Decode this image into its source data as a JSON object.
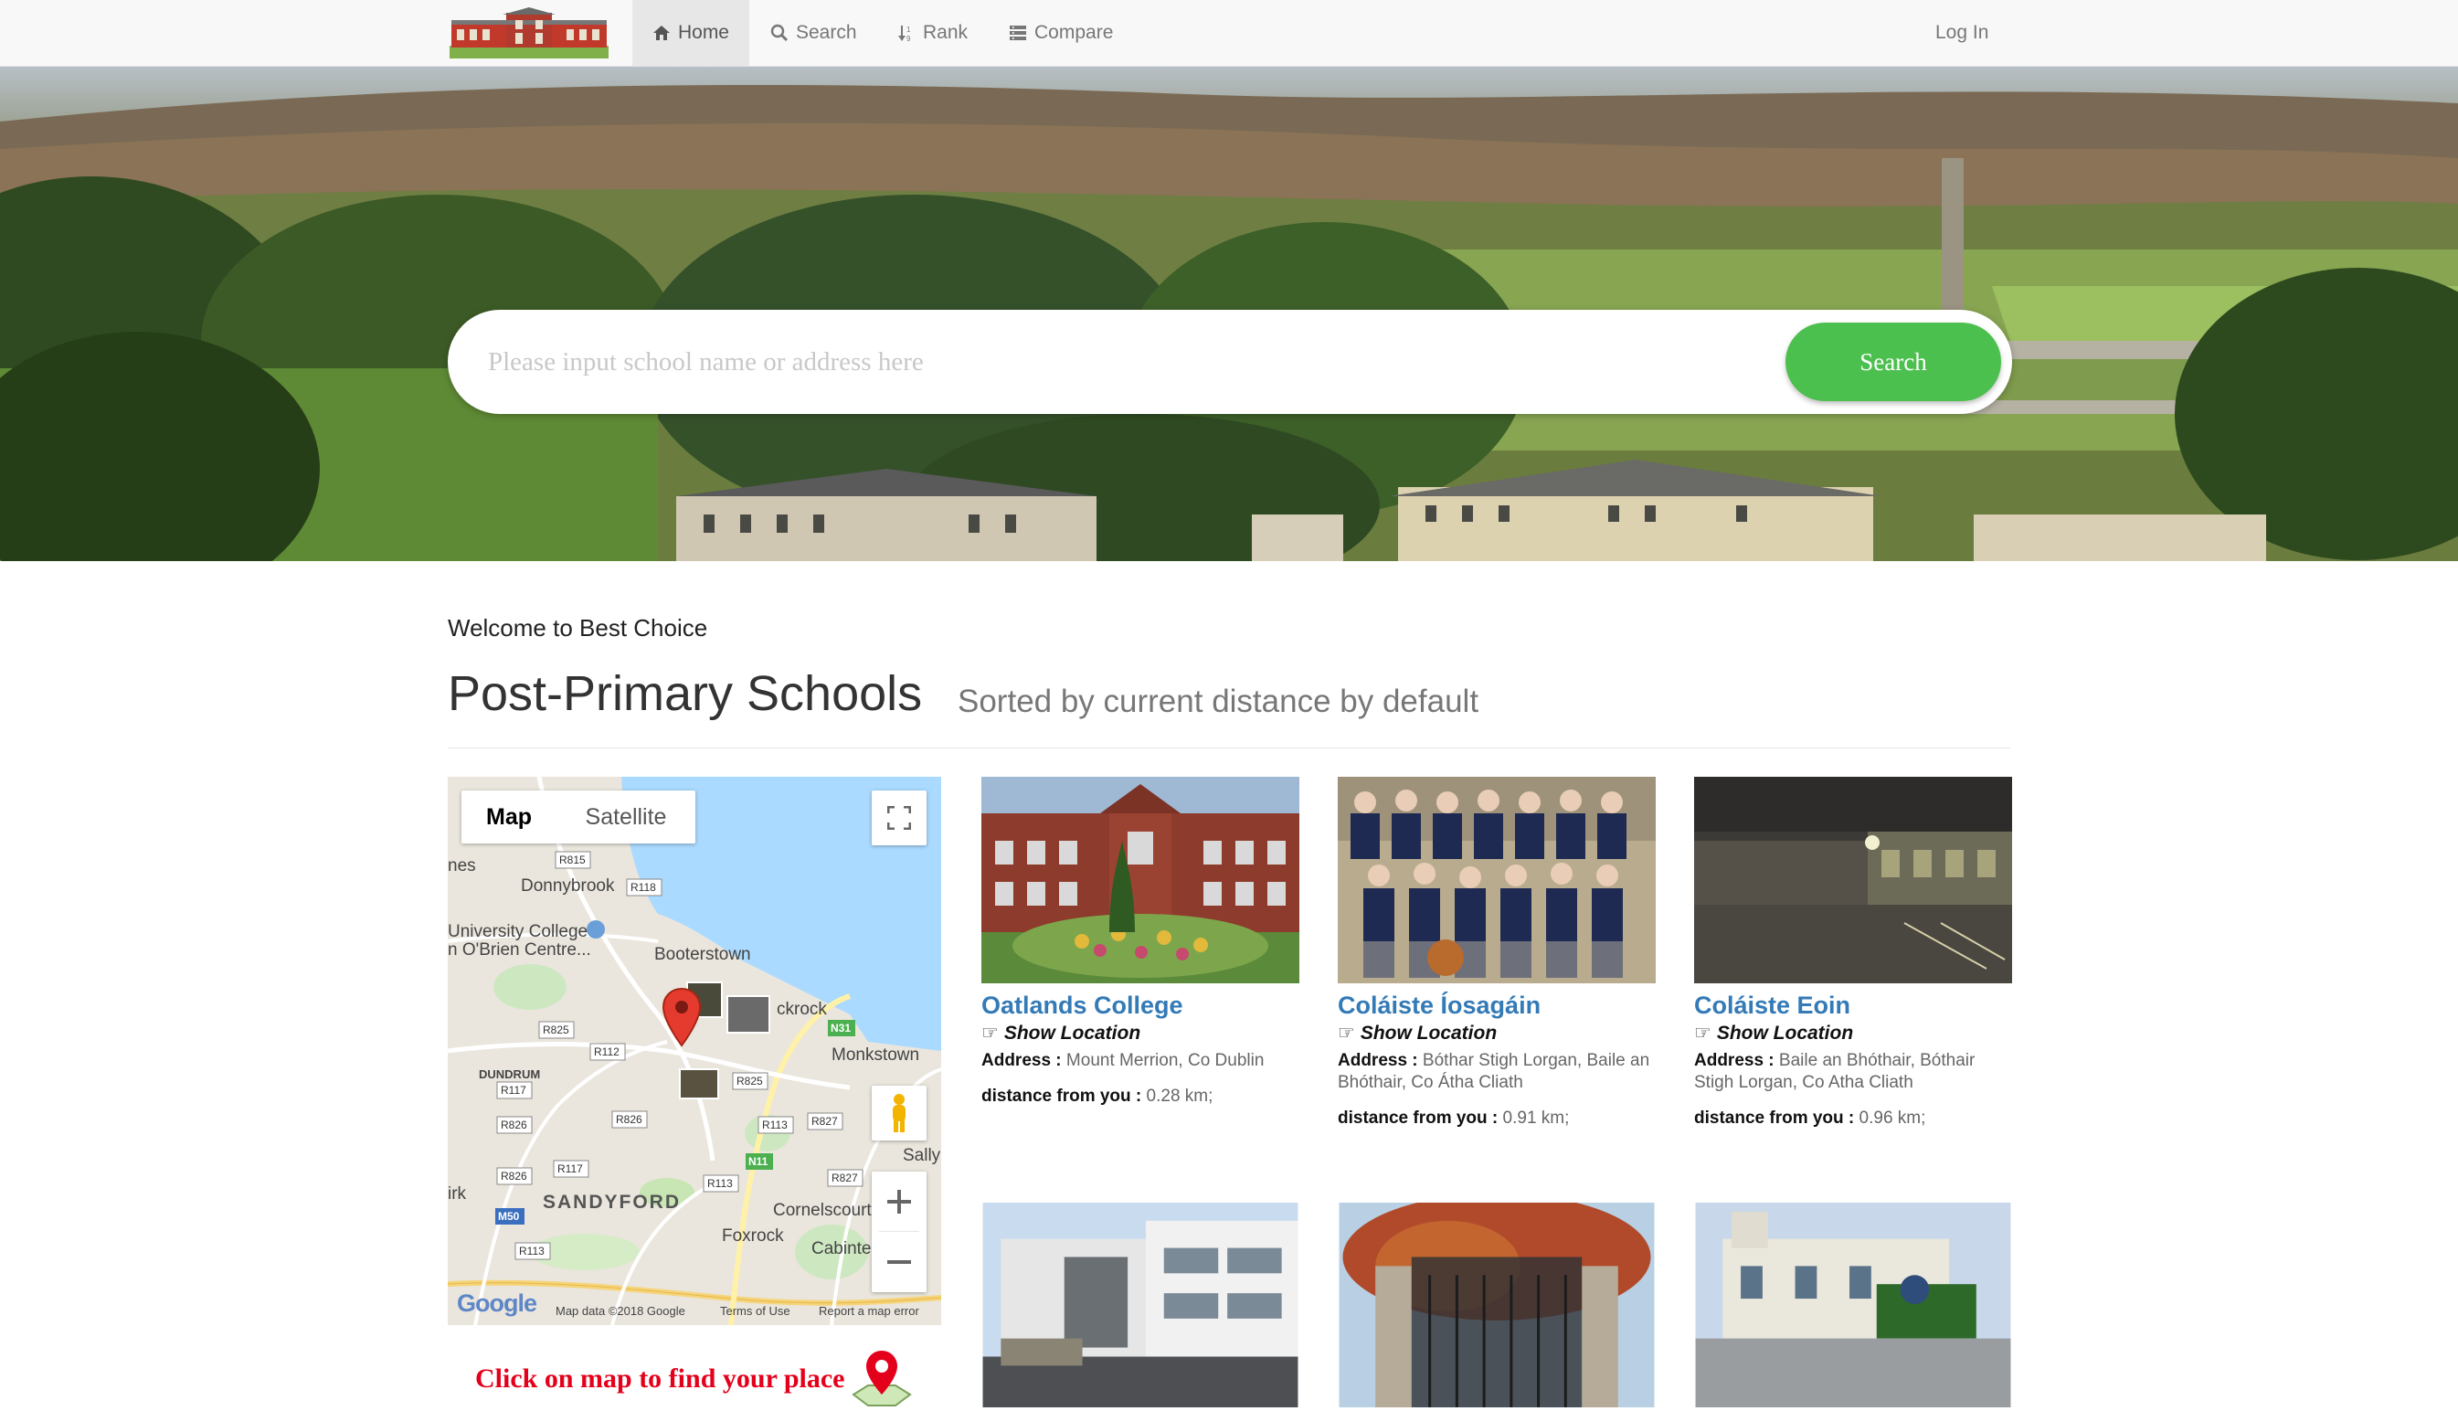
{
  "nav": {
    "home": "Home",
    "search": "Search",
    "rank": "Rank",
    "compare": "Compare",
    "login": "Log In"
  },
  "hero": {
    "search_placeholder": "Please input school name or address here",
    "search_button": "Search"
  },
  "main": {
    "welcome": "Welcome to Best Choice",
    "title": "Post-Primary Schools",
    "subtitle": "Sorted by current distance by default"
  },
  "map": {
    "type_map": "Map",
    "type_satellite": "Satellite",
    "labels": [
      "Donnybrook",
      "nes",
      "University College",
      "n O'Brien Centre...",
      "Booterstown",
      "ckrock",
      "Monkstown",
      "DUNDRUM",
      "SANDYFORD",
      "Foxrock",
      "Cornelscourt",
      "Cabinte",
      "Sally",
      "irk"
    ],
    "road_labels": [
      "R815",
      "R118",
      "R825",
      "R112",
      "R117",
      "R826",
      "R826",
      "R825",
      "R113",
      "R827",
      "R117",
      "R826",
      "R113",
      "R827",
      "R113",
      "N31",
      "N11",
      "M50"
    ],
    "attribution": "Map data ©2018 Google",
    "terms": "Terms of Use",
    "report": "Report a map error",
    "google": "Google",
    "click_text": "Click on map to find your place"
  },
  "schools": [
    {
      "name": "Oatlands College",
      "show_location": "Show Location",
      "address_label": "Address :",
      "address": "Mount Merrion, Co Dublin",
      "distance_label": "distance from you :",
      "distance": "0.28 km;"
    },
    {
      "name": "Coláiste Íosagáin",
      "show_location": "Show Location",
      "address_label": "Address :",
      "address": "Bóthar Stigh Lorgan, Baile an Bhóthair, Co Átha Cliath",
      "distance_label": "distance from you :",
      "distance": "0.91 km;"
    },
    {
      "name": "Coláiste Eoin",
      "show_location": "Show Location",
      "address_label": "Address :",
      "address": "Baile an Bhóthair, Bóthair Stigh Lorgan, Co Atha Cliath",
      "distance_label": "distance from you :",
      "distance": "0.96 km;"
    }
  ],
  "colors": {
    "accent": "#337ab7",
    "search_button": "#4cc04e",
    "click_text": "#e4001b"
  }
}
